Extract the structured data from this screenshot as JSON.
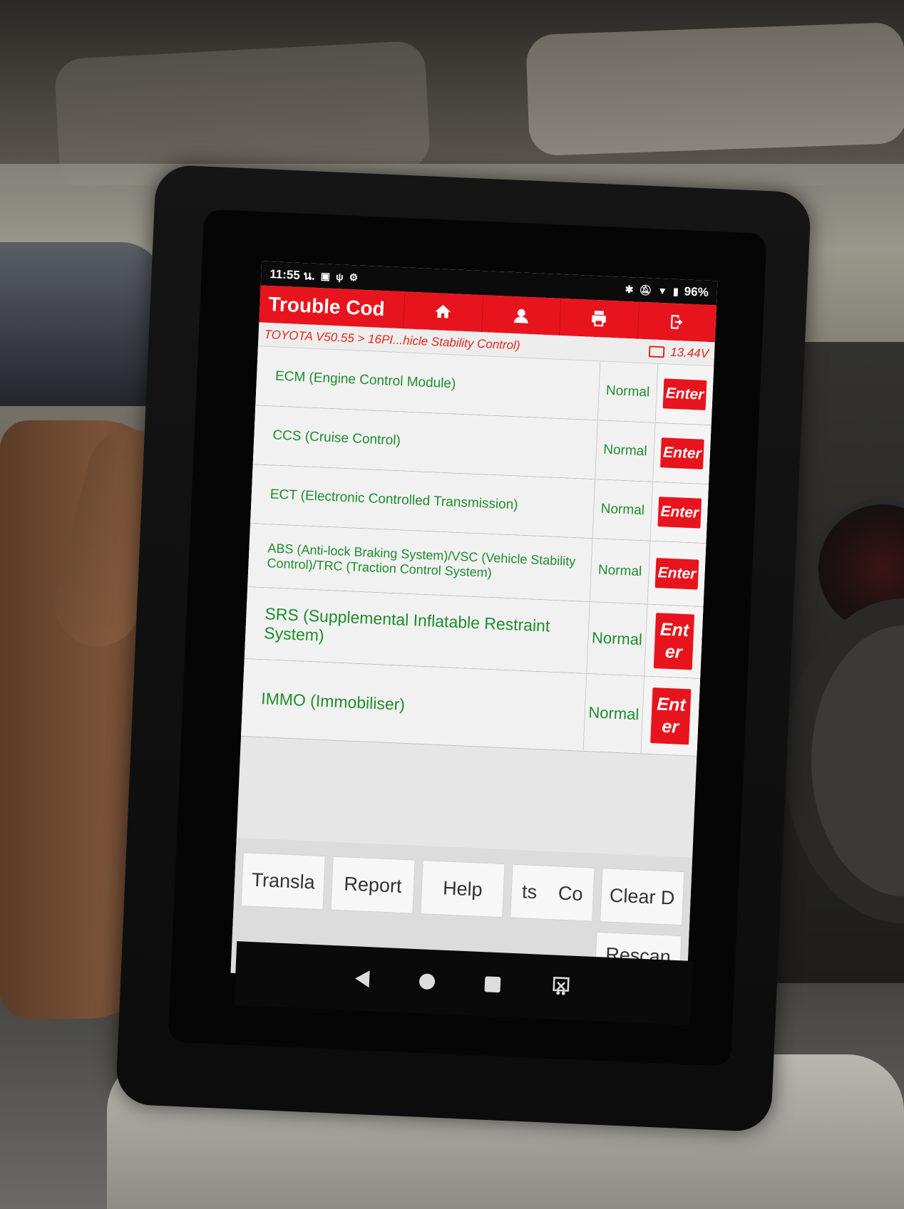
{
  "statusbar": {
    "time": "11:55 น.",
    "battery": "96%"
  },
  "appbar": {
    "title": "Trouble Cod",
    "icons": [
      "home-icon",
      "technician-icon",
      "print-icon",
      "exit-icon"
    ]
  },
  "breadcrumb": {
    "path": "TOYOTA V50.55 > 16PI...hicle Stability Control)",
    "voltage": "13.44V"
  },
  "systems": [
    {
      "name": "ECM (Engine Control Module)",
      "status": "Normal",
      "action": "Enter"
    },
    {
      "name": "CCS (Cruise Control)",
      "status": "Normal",
      "action": "Enter"
    },
    {
      "name": "ECT (Electronic Controlled Transmission)",
      "status": "Normal",
      "action": "Enter"
    },
    {
      "name": "ABS (Anti-lock Braking System)/VSC (Vehicle Stability Control)/TRC (Traction Control System)",
      "status": "Normal",
      "action": "Enter"
    },
    {
      "name": "SRS (Supplemental Inflatable Restraint System)",
      "status": "Normal",
      "action": "Enter"
    },
    {
      "name": "IMMO (Immobiliser)",
      "status": "Normal",
      "action": "Enter"
    }
  ],
  "toolbar": {
    "translate": "Transla",
    "report": "Report",
    "help": "Help",
    "components": "ts    Co",
    "clear": "Clear D",
    "rescan": "Rescan"
  },
  "colors": {
    "accent": "#e8141d",
    "status_text": "#1d8c2b"
  }
}
